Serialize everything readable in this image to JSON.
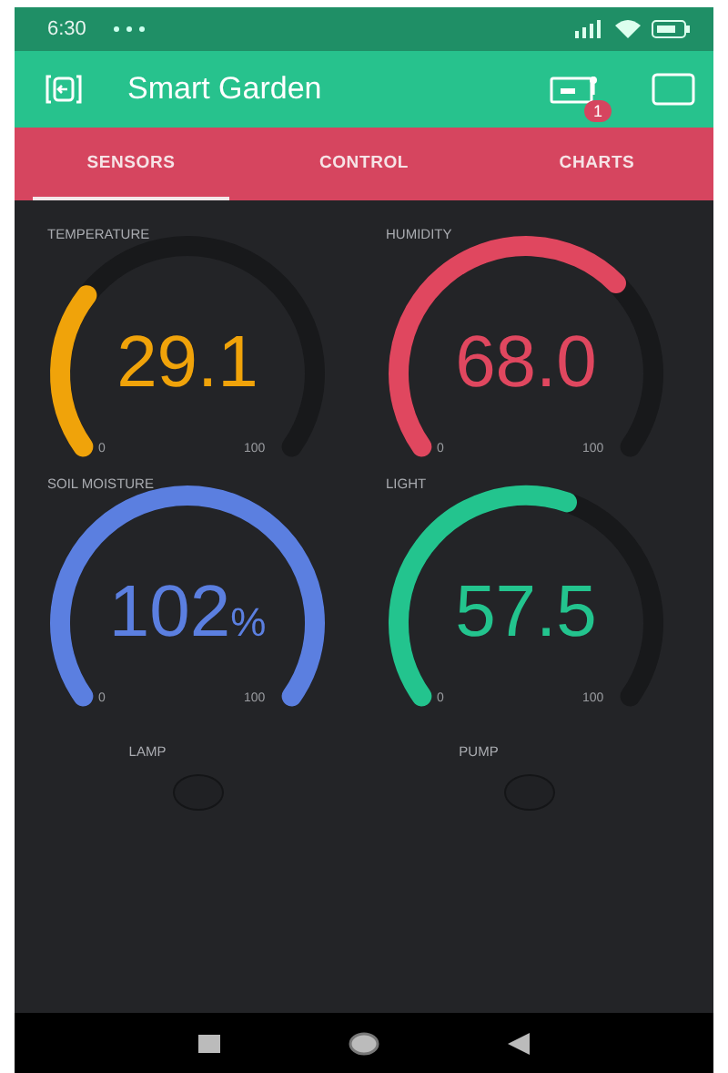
{
  "status_bar": {
    "time": "6:30"
  },
  "app_bar": {
    "title": "Smart Garden",
    "badge": "1"
  },
  "tabs": [
    {
      "label": "SENSORS",
      "selected": true
    },
    {
      "label": "CONTROL",
      "selected": false
    },
    {
      "label": "CHARTS",
      "selected": false
    }
  ],
  "gauges": [
    {
      "label": "TEMPERATURE",
      "value": "29.1",
      "min": "0",
      "max": "100",
      "color": "#f0a30a"
    },
    {
      "label": "HUMIDITY",
      "value": "68.0",
      "min": "0",
      "max": "100",
      "color": "#e0475f"
    },
    {
      "label": "SOIL MOISTURE",
      "value": "102",
      "unit": "%",
      "min": "0",
      "max": "100",
      "color": "#5b7fe0"
    },
    {
      "label": "LIGHT",
      "value": "57.5",
      "min": "0",
      "max": "100",
      "color": "#23c48e"
    }
  ],
  "leds": [
    {
      "label": "LAMP",
      "on": false
    },
    {
      "label": "PUMP",
      "on": false
    }
  ]
}
